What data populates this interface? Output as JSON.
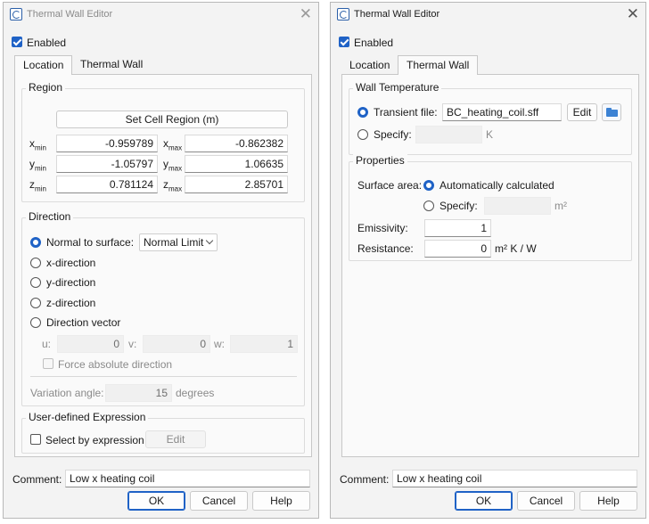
{
  "left": {
    "title": "Thermal Wall Editor",
    "enabled_label": "Enabled",
    "tabs": [
      "Location",
      "Thermal Wall"
    ],
    "region": {
      "title": "Region",
      "set_button": "Set Cell Region (m)",
      "rows": [
        {
          "min_label": "x",
          "min_sub": "min",
          "min": "-0.959789",
          "max_label": "x",
          "max_sub": "max",
          "max": "-0.862382"
        },
        {
          "min_label": "y",
          "min_sub": "min",
          "min": "-1.05797",
          "max_label": "y",
          "max_sub": "max",
          "max": "1.06635"
        },
        {
          "min_label": "z",
          "min_sub": "min",
          "min": "0.781124",
          "max_label": "z",
          "max_sub": "max",
          "max": "2.85701"
        }
      ]
    },
    "direction": {
      "title": "Direction",
      "normal_label": "Normal to surface:",
      "normal_select": "Normal Limit",
      "x": "x-direction",
      "y": "y-direction",
      "z": "z-direction",
      "vector": "Direction vector",
      "u_label": "u:",
      "u": "0",
      "v_label": "v:",
      "v": "0",
      "w_label": "w:",
      "w": "1",
      "force": "Force absolute direction",
      "variation_label": "Variation angle:",
      "variation": "15",
      "variation_unit": "degrees"
    },
    "expr": {
      "title": "User-defined Expression",
      "select_label": "Select by expression",
      "edit": "Edit"
    },
    "comment_label": "Comment:",
    "comment": "Low x heating coil",
    "ok": "OK",
    "cancel": "Cancel",
    "help": "Help"
  },
  "right": {
    "title": "Thermal Wall Editor",
    "enabled_label": "Enabled",
    "tabs": [
      "Location",
      "Thermal Wall"
    ],
    "wall_temp": {
      "title": "Wall Temperature",
      "transient_label": "Transient file:",
      "transient_file": "BC_heating_coil.sff",
      "edit": "Edit",
      "specify_label": "Specify:",
      "specify_unit": "K"
    },
    "properties": {
      "title": "Properties",
      "surface_label": "Surface area:",
      "auto_label": "Automatically calculated",
      "specify_label": "Specify:",
      "area_unit": "m²",
      "emissivity_label": "Emissivity:",
      "emissivity": "1",
      "resistance_label": "Resistance:",
      "resistance": "0",
      "resistance_unit": "m² K / W"
    },
    "comment_label": "Comment:",
    "comment": "Low x heating coil",
    "ok": "OK",
    "cancel": "Cancel",
    "help": "Help"
  },
  "colors": {
    "accent": "#1f62c6",
    "window_bg": "#f3f3f3",
    "panel_bg": "#fafafa"
  },
  "icons": [
    "app-icon",
    "close-icon",
    "checkbox-icon",
    "radio-icon",
    "chevron-down-icon",
    "folder-open-icon"
  ]
}
